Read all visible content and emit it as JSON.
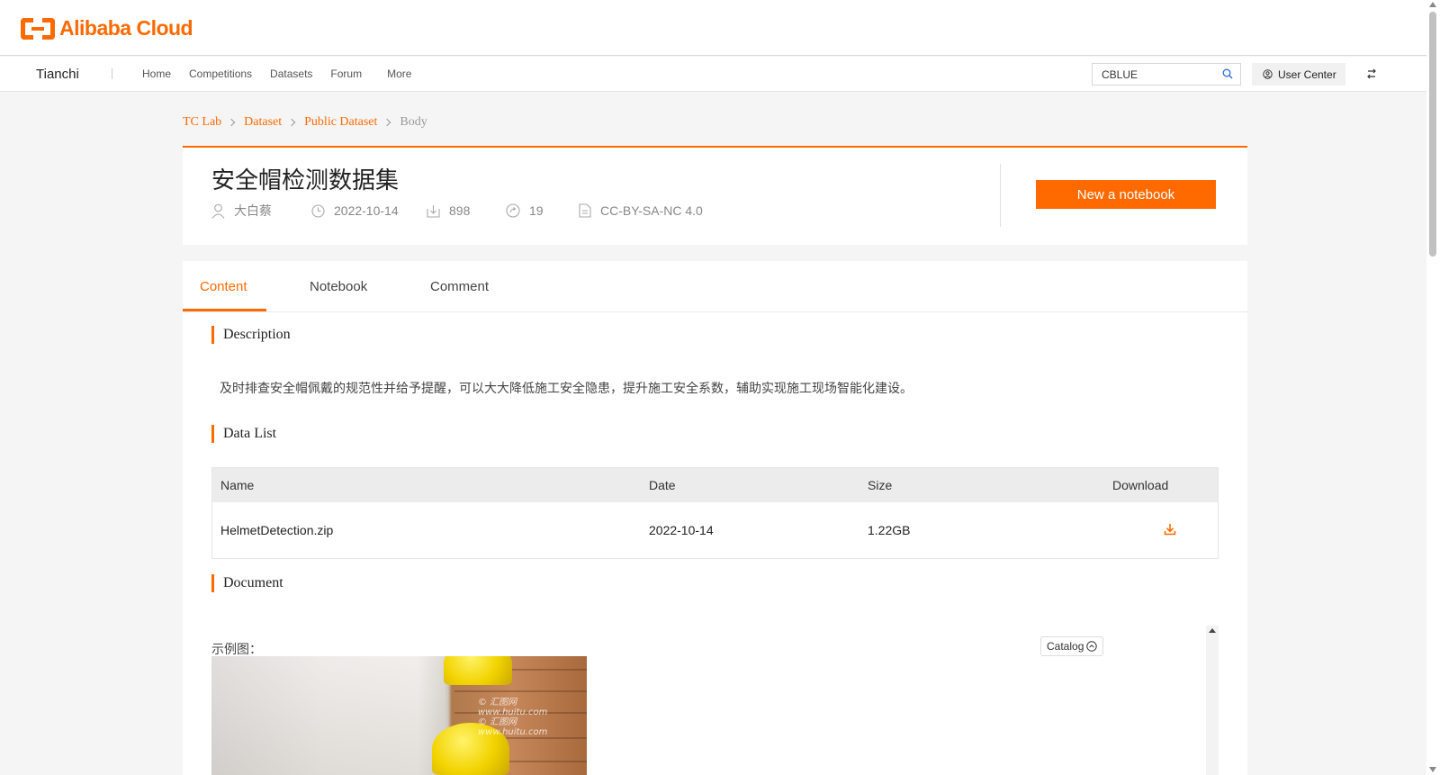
{
  "brand": {
    "logo_text": "Alibaba Cloud",
    "color": "#ff6a00"
  },
  "nav": {
    "product": "Tianchi",
    "links": [
      "Home",
      "Competitions",
      "Datasets",
      "Forum",
      "More"
    ],
    "search_value": "CBLUE",
    "user_center": "User Center"
  },
  "breadcrumb": [
    "TC Lab",
    "Dataset",
    "Public Dataset",
    "Body"
  ],
  "dataset": {
    "title": "安全帽检测数据集",
    "author": "大白蔡",
    "date": "2022-10-14",
    "downloads": "898",
    "shares": "19",
    "license": "CC-BY-SA-NC 4.0",
    "new_notebook": "New a notebook"
  },
  "tabs": [
    "Content",
    "Notebook",
    "Comment"
  ],
  "description": {
    "title": "Description",
    "text": "及时排查安全帽佩戴的规范性并给予提醒，可以大大降低施工安全隐患，提升施工安全系数，辅助实现施工现场智能化建设。"
  },
  "data_list": {
    "title": "Data List",
    "headers": [
      "Name",
      "Date",
      "Size",
      "Download"
    ],
    "rows": [
      {
        "name": "HelmetDetection.zip",
        "date": "2022-10-14",
        "size": "1.22GB"
      }
    ]
  },
  "document": {
    "title": "Document",
    "example_label": "示例图：",
    "catalog": "Catalog",
    "watermarks": [
      "© 汇图网 www.huitu.com",
      "© 汇图网 www.huitu.com"
    ]
  },
  "icons": [
    "search-icon",
    "user-icon",
    "swap-icon",
    "clock-icon",
    "download-icon",
    "share-icon",
    "license-icon",
    "chevron-up-icon"
  ]
}
